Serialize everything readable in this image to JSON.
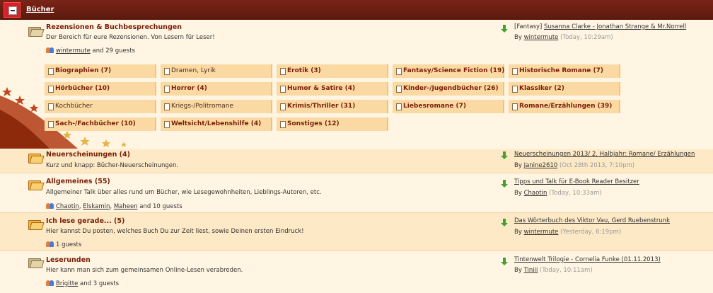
{
  "category": {
    "title": "Bücher"
  },
  "forums": [
    {
      "title": "Rezensionen & Buchbesprechungen",
      "desc": "Der Bereich für eure Rezensionen. Von Lesern für Leser!",
      "users": [
        "wintermute"
      ],
      "guests": "and 29 guests",
      "last_link": "Susanna Clarke - Jonathan Strange & Mr.Norrell",
      "last_prefix": "[Fantasy]",
      "last_user": "wintermute",
      "last_time": "(Today, 10:29am)"
    },
    {
      "title": "Neuerscheinungen (4)",
      "desc": "Kurz und knapp: Bücher-Neuerscheinungen.",
      "last_link": "Neuerscheinungen 2013/ 2. Halbjahr: Romane/ Erzählungen",
      "last_user": "Janine2610",
      "last_time": "(Oct 28th 2013, 7:10pm)"
    },
    {
      "title": "Allgemeines (55)",
      "desc": "Allgemeiner Talk über alles rund um Bücher, wie Lesegewohnheiten, Lieblings-Autoren, etc.",
      "users": [
        "Chaotin",
        "Elskamin",
        "Maheen"
      ],
      "guests": "and 10 guests",
      "last_link": "Tipps und Talk für E-Book Reader Besitzer",
      "last_user": "Chaotin",
      "last_time": "(Today, 10:33am)"
    },
    {
      "title": "Ich lese gerade... (5)",
      "desc": "Hier kannst Du posten, welches Buch Du zur Zeit liest, sowie Deinen ersten Eindruck!",
      "guests": "1 guests",
      "last_link": "Das Wörterbuch des Viktor Vau, Gerd Ruebenstrunk",
      "last_user": "wintermute",
      "last_time": "(Yesterday, 6:19pm)"
    },
    {
      "title": "Leserunden",
      "desc": "Hier kann man sich zum gemeinsamen Online-Lesen verabreden.",
      "users": [
        "Brigitte"
      ],
      "guests": "and 3 guests",
      "last_link": "Tintenwelt Trilogie - Cornelia Funke (01.11.2013)",
      "last_user": "Tiniii",
      "last_time": "(Today, 10:11am)"
    }
  ],
  "by_label": "By",
  "subforums": [
    [
      {
        "label": "Biographien (7)",
        "bold": true
      },
      {
        "label": "Dramen, Lyrik",
        "bold": false
      },
      {
        "label": "Erotik (3)",
        "bold": true
      },
      {
        "label": "Fantasy/Science Fiction (19)",
        "bold": true
      },
      {
        "label": "Historische Romane (7)",
        "bold": true
      }
    ],
    [
      {
        "label": "Hörbücher (10)",
        "bold": true
      },
      {
        "label": "Horror (4)",
        "bold": true
      },
      {
        "label": "Humor & Satire (4)",
        "bold": true
      },
      {
        "label": "Kinder-/Jugendbücher (26)",
        "bold": true
      },
      {
        "label": "Klassiker (2)",
        "bold": true
      }
    ],
    [
      {
        "label": "Kochbücher",
        "bold": false
      },
      {
        "label": "Kriegs-/Politromane",
        "bold": false
      },
      {
        "label": "Krimis/Thriller (31)",
        "bold": true
      },
      {
        "label": "Liebesromane (7)",
        "bold": true
      },
      {
        "label": "Romane/Erzählungen (39)",
        "bold": true
      }
    ],
    [
      {
        "label": "Sach-/Fachbücher (10)",
        "bold": true
      },
      {
        "label": "Weltsicht/Lebenshilfe (4)",
        "bold": true
      },
      {
        "label": "Sonstiges (12)",
        "bold": true
      }
    ]
  ],
  "colors": {
    "header": "#6b1f12",
    "collapse": "#d6202a",
    "title": "#7a1f0a",
    "subforum_bg": "#fbd9a2",
    "arrow": "#44a030"
  }
}
